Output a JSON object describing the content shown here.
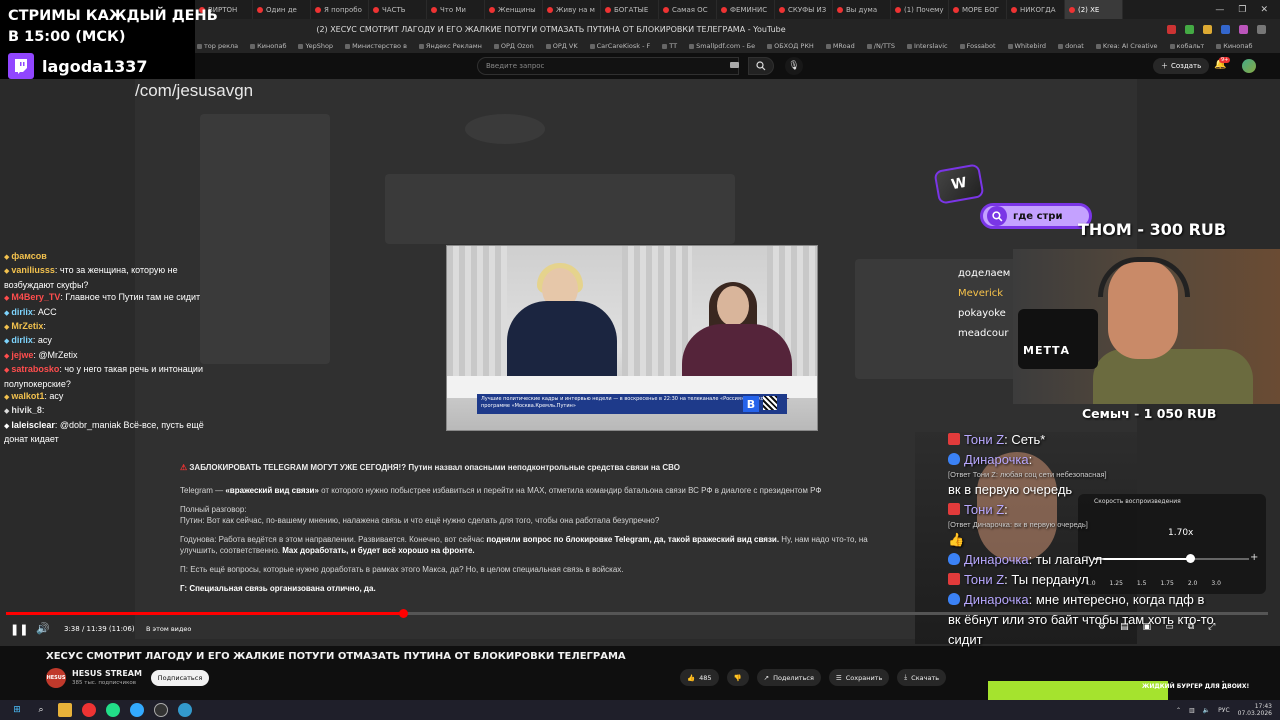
{
  "browser": {
    "tabs": [
      "ВИРТОН",
      "Один де",
      "Я попробо",
      "ЧАСТЬ",
      "Что Ми",
      "Женщины",
      "Живу на м",
      "БОГАТЫЕ",
      "Самая ОС",
      "ФЕМИНИС",
      "СКУФЫ ИЗ",
      "Вы дума",
      "(1) Почему",
      "МОРЕ БОГ",
      "НИКОГДА",
      "(2) ХЕ"
    ],
    "page_title": "(2) ХЕСУС СМОТРИТ ЛАГОДУ И ЕГО ЖАЛКИЕ ПОТУГИ ОТМАЗАТЬ ПУТИНА ОТ БЛОКИРОВКИ ТЕЛЕГРАМА - YouTube",
    "bookmarks": [
      "тор рекла",
      "Кинопаб",
      "YepShop",
      "Министерство в",
      "Яндекс Рекламн",
      "ОРД Ozon",
      "ОРД VK",
      "CarCareKiosk - F",
      "TT",
      "Smallpdf.com - Бе",
      "ОБХОД РКН",
      "MRoad",
      "/N/TTS",
      "Interslavic",
      "Fossabot",
      "Whitebird",
      "donat",
      "Krea: AI Creative",
      "кобальт",
      "Кинопаб"
    ]
  },
  "youtube": {
    "search_placeholder": "Введите запрос",
    "create_label": "Создать",
    "notif_count": "9+"
  },
  "stream_banner": {
    "line1": "СТРИМЫ КАЖДЫЙ ДЕНЬ",
    "line2": "В 15:00 (МСК)",
    "twitch_name": "lagoda1337"
  },
  "video": {
    "url_overlay": "/com/jesusavgn",
    "inner_caption": "Лучшие политические кадры и интервью недели — в воскресенье в 22:30 на телеканале «Россия» только в программе «Москва.Кремль.Путин»",
    "channel_logo": "В",
    "article": {
      "headline": "ЗАБЛОКИРОВАТЬ TELEGRAM МОГУТ УЖЕ СЕГОДНЯ!? Путин назвал опасными неподконтрольные средства связи на СВО",
      "p1_a": "Telegram — ",
      "p1_b": "«вражеский вид связи»",
      "p1_c": " от которого нужно побыстрее избавиться и перейти на MAX, отметила командир батальона связи ВС РФ в диалоге с президентом РФ",
      "p2": "Полный разговор:",
      "p3": "Путин: Вот как сейчас, по-вашему мнению, налажена связь и что ещё нужно сделать для того, чтобы она работала безупречно?",
      "p4_a": "Годунова: Работа ведётся в этом направлении. Развивается. Конечно, вот сейчас ",
      "p4_b": "подняли вопрос по блокировке Telegram, да, такой вражеский вид связи.",
      "p4_c": " Ну, нам надо что-то, на",
      "p5_a": "улучшить, соответственно. ",
      "p5_b": "Max доработать, и будет всё хорошо на фронте.",
      "p6": "П: Есть ещё вопросы, которые нужно доработать в рамках этого Макса, да? Но, в целом специальная связь в войсках.",
      "p7": "Г: Специальная связь организована отлично, да."
    },
    "time": "3:38 / 11:39 (11:06)",
    "chapter": "В этом видео",
    "progress_fraction": 0.315,
    "title": "ХЕСУС СМОТРИТ ЛАГОДУ И ЕГО ЖАЛКИЕ ПОТУГИ ОТМАЗАТЬ ПУТИНА ОТ БЛОКИРОВКИ ТЕЛЕГРАМА",
    "channel": "HESUS STREAM",
    "channel_avatar": "HESUS",
    "subs": "385 тыс. подписчиков",
    "subscribe": "Подписаться",
    "likes": "485",
    "share": "Поделиться",
    "save": "Сохранить",
    "download": "Скачать"
  },
  "left_chat": [
    {
      "user": "фамсов",
      "text": "",
      "color": "#f2c14e"
    },
    {
      "user": "vaniliusss",
      "text": ": что за женщина, которую не возбуждают скуфы?",
      "color": "#f2c14e"
    },
    {
      "user": "M4Bery_TV",
      "text": ": Главное что Путин там не сидит",
      "color": "#ff4d4d"
    },
    {
      "user": "dirlix",
      "text": ": АСС",
      "color": "#7dd3fc"
    },
    {
      "user": "MrZetix",
      "text": ":",
      "color": "#f2c14e"
    },
    {
      "user": "dirlix",
      "text": ": асу",
      "color": "#7dd3fc"
    },
    {
      "user": "jejwe",
      "text": ": @MrZetix",
      "color": "#ff4d4d"
    },
    {
      "user": "satrabosko",
      "text": ": чо у него такая речь и интонации полупокерские?",
      "color": "#ff4d4d"
    },
    {
      "user": "walkot1",
      "text": ": асу",
      "color": "#f2c14e"
    },
    {
      "user": "hivik_8",
      "text": ":",
      "color": "#ddd"
    },
    {
      "user": "laleisclear",
      "text": ": @dobr_maniak Всё-все, пусть ещё донат кидает",
      "color": "#fff"
    }
  ],
  "overlays": {
    "badge": "W",
    "search_pill": "где стри",
    "donate1": "THOM - 300 RUB",
    "names": [
      "доделаем",
      "Meverick",
      "pokayoke",
      "meadcour"
    ],
    "mic_brand": "MEТТА",
    "donate2": "Семыч - 1 050 RUB"
  },
  "right_chat": [
    {
      "type": "gift",
      "user": "Тони Z",
      "text": ": Сеть*"
    },
    {
      "type": "shield",
      "user": "Динарочка",
      "text": ":"
    },
    {
      "type": "reply",
      "text": "[Ответ Тони Z: любая соц сети небезопасная]"
    },
    {
      "type": "plain",
      "text": "вк в первую очередь"
    },
    {
      "type": "gift",
      "user": "Тони Z",
      "text": ":"
    },
    {
      "type": "reply",
      "text": "[Ответ Динарочка: вк в первую очередь]"
    },
    {
      "type": "plain",
      "text": "👍"
    },
    {
      "type": "shield",
      "user": "Динарочка",
      "text": ": ты лаганул"
    },
    {
      "type": "gift",
      "user": "Тони Z",
      "text": ": Ты перданул"
    },
    {
      "type": "shield",
      "user": "Динарочка",
      "text": ": мне интересно, когда пдф в"
    },
    {
      "type": "plain",
      "text": "вк ёбнут или это байт чтобы там хоть кто-то"
    },
    {
      "type": "plain",
      "text": "сидит"
    }
  ],
  "speed": {
    "title": "Скорость воспроизведения",
    "value": "1.70x",
    "fraction": 0.62,
    "options": [
      "1.0",
      "1.25",
      "1.5",
      "1.75",
      "2.0",
      "3.0"
    ]
  },
  "ad": {
    "text": "ЖИДКИЙ БУРГЕР ДЛЯ ДВОИХ!"
  },
  "taskbar": {
    "lang": "РУС",
    "time": "17:43",
    "date": "07.03.2026"
  },
  "colors": {
    "twitch": "#9146ff",
    "youtube_red": "#ff0000",
    "chat_name": "#b8a8ff"
  }
}
